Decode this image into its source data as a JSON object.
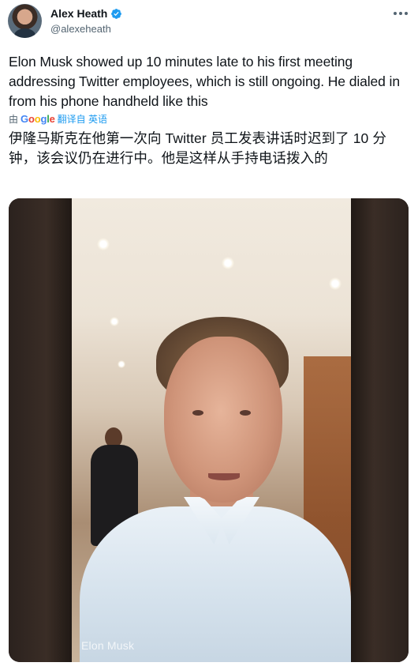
{
  "author": {
    "display_name": "Alex Heath",
    "handle": "@alexeheath",
    "verified": true
  },
  "tweet": {
    "text": "Elon Musk showed up 10 minutes late to his first meeting addressing Twitter employees, which is still ongoing. He dialed in from his phone handheld like this",
    "translated_by_prefix": "由",
    "translated_by_provider": "Google",
    "translate_link": "翻译自 英语",
    "translated_text": "伊隆马斯克在他第一次向 Twitter 员工发表讲话时迟到了 10 分钟，该会议仍在进行中。他是这样从手持电话拨入的"
  },
  "media": {
    "watermark": "Elon Musk"
  },
  "icons": {
    "verified": "verified-badge-icon",
    "more": "more-options-icon"
  },
  "colors": {
    "link": "#1d9bf0",
    "secondary_text": "#536471"
  }
}
